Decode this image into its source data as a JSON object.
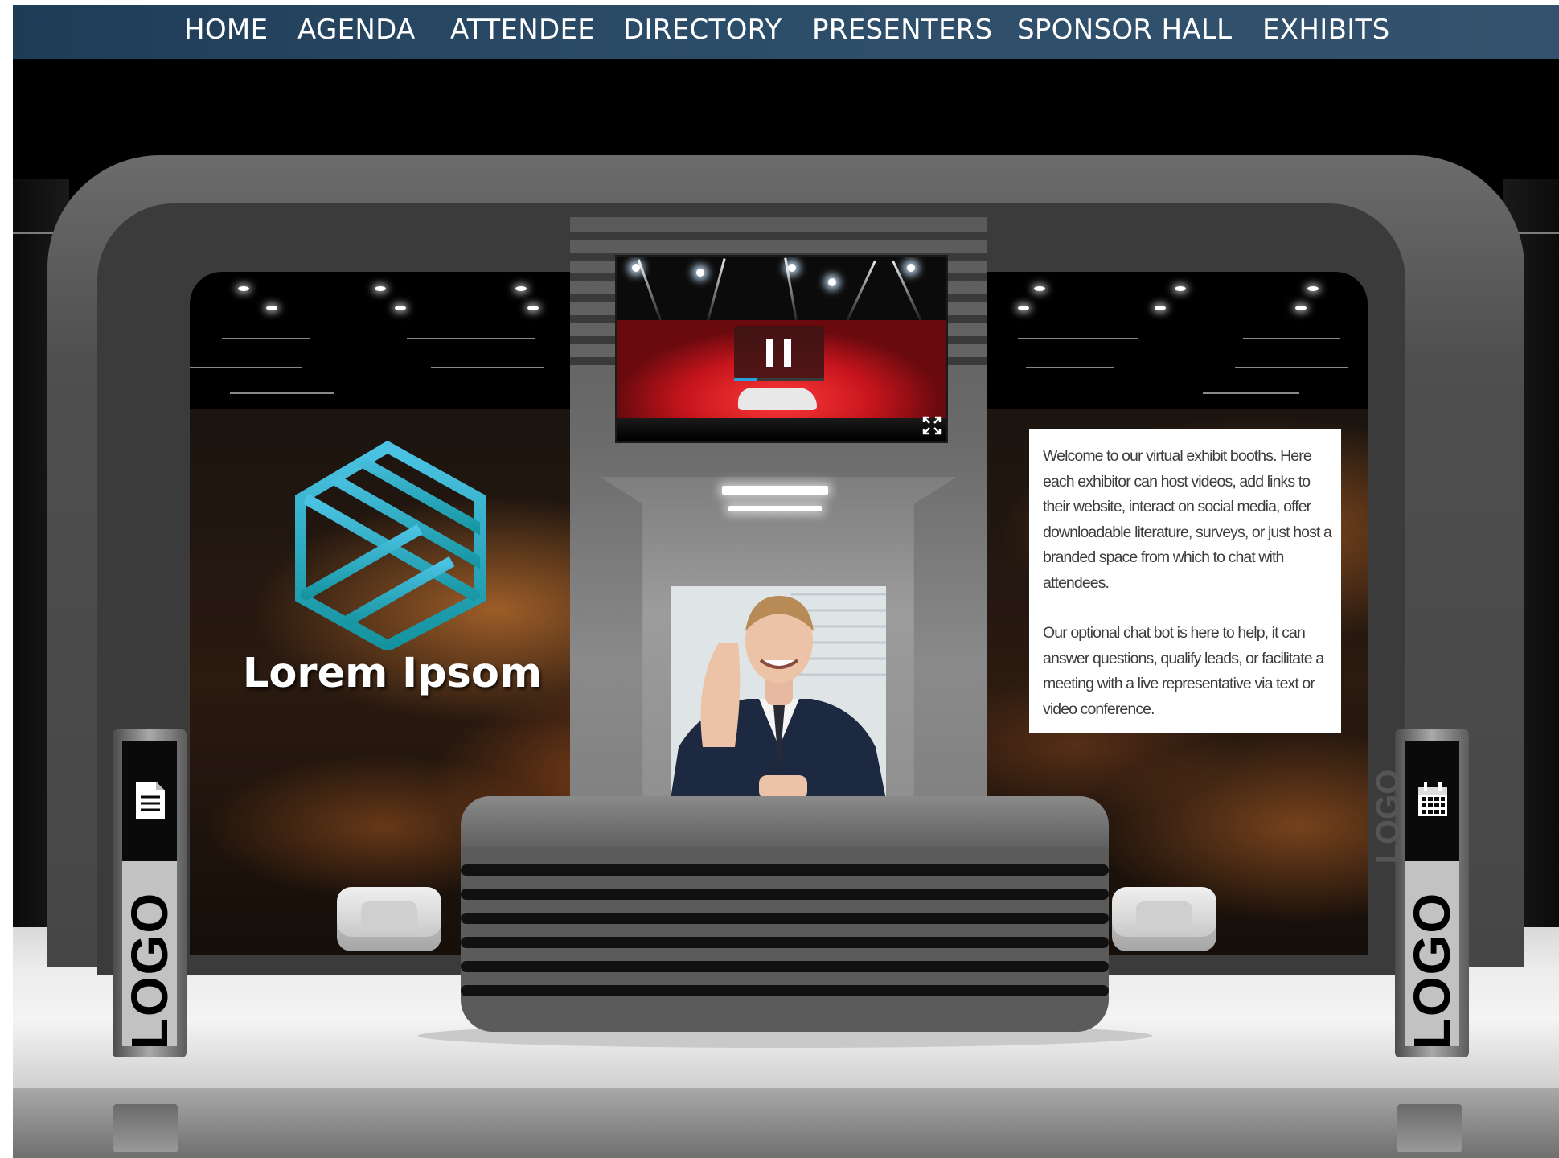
{
  "nav": {
    "items": [
      {
        "label": "HOME"
      },
      {
        "label": "AGENDA"
      },
      {
        "label": "ATTENDEE"
      },
      {
        "label": "DIRECTORY"
      },
      {
        "label": "PRESENTERS"
      },
      {
        "label": "SPONSOR HALL"
      },
      {
        "label": "EXHIBITS"
      }
    ],
    "colors": {
      "bar": "#2c4d69",
      "text": "#ffffff"
    }
  },
  "booth": {
    "brand_name": "Lorem Ipsom",
    "brand_colors": {
      "logo_light": "#3fb6d9",
      "logo_dark": "#1b8fa6"
    },
    "video": {
      "state": "playing",
      "controls": [
        "pause-icon",
        "fullscreen-icon"
      ],
      "progress": 0.25,
      "accent": "#2aa0e0"
    },
    "info": {
      "paragraph_1": "Welcome to our virtual exhibit booths. Here each exhibitor can host videos, add links to their website, interact on social media, offer downloadable literature, surveys, or just host a branded space from which to chat with attendees.",
      "paragraph_2": "Our optional chat bot is here to help, it can answer questions, qualify leads, or facilitate a meeting with a live representative via text or video conference."
    },
    "kiosks": {
      "left": {
        "icon": "document-icon",
        "logo": "LOGO"
      },
      "right": {
        "icon": "calendar-icon",
        "logo": "LOGO"
      },
      "side_logo": "LOGO"
    }
  }
}
